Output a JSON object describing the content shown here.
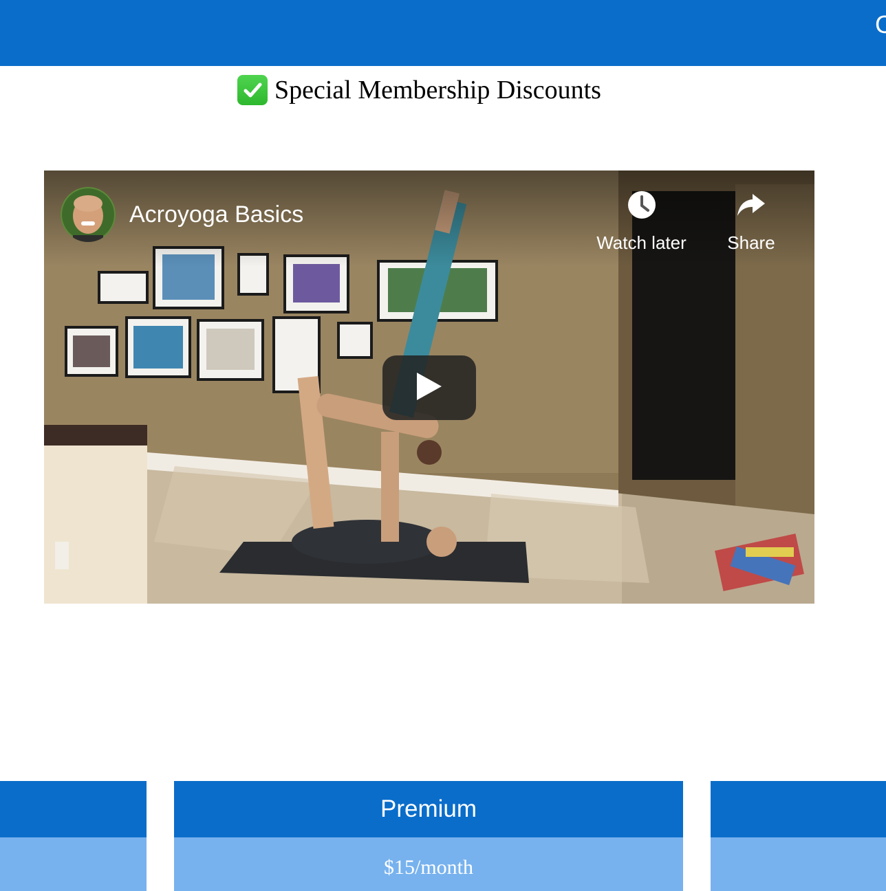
{
  "header": {
    "edge_text": "C"
  },
  "feature": {
    "check_icon": "check-mark-button-icon",
    "text": "Special Membership Discounts"
  },
  "video": {
    "title": "Acroyoga Basics",
    "watch_later_label": "Watch later",
    "share_label": "Share",
    "icons": [
      "clock-icon",
      "share-arrow-icon",
      "play-icon"
    ]
  },
  "pricing": {
    "plans": [
      {
        "name": "",
        "price": ""
      },
      {
        "name": "Premium",
        "price": "$15/month"
      },
      {
        "name": "",
        "price": ""
      }
    ]
  },
  "colors": {
    "brand_blue": "#0a6dca",
    "price_blue": "#77b2ee",
    "check_green": "#2eb82e"
  }
}
